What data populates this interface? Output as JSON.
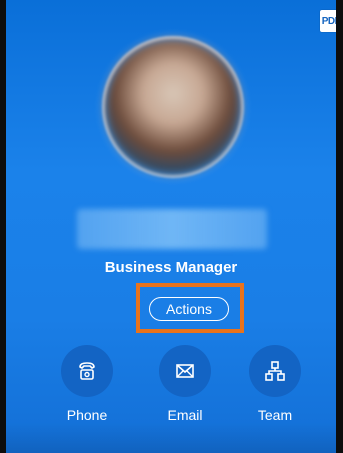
{
  "header": {
    "pdf_label": "PDF"
  },
  "profile": {
    "job_title": "Business Manager"
  },
  "actions_button": {
    "label": "Actions"
  },
  "quick_actions": [
    {
      "label": "Phone",
      "icon": "phone-icon"
    },
    {
      "label": "Email",
      "icon": "email-icon"
    },
    {
      "label": "Team",
      "icon": "team-icon"
    }
  ],
  "colors": {
    "card_blue": "#1a7ee6",
    "circle_blue": "#1364c4",
    "highlight_orange": "#e8731c"
  }
}
